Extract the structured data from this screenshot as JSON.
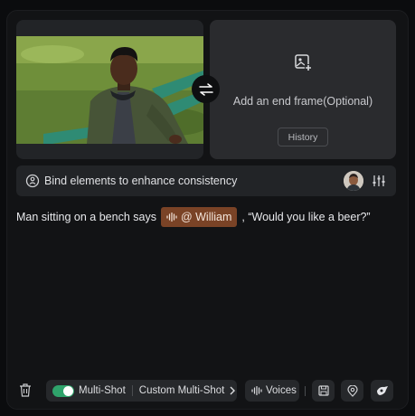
{
  "start_frame": {
    "image_icon": "person-on-bench-photo"
  },
  "swap": {
    "icon": "swap-arrows-icon"
  },
  "end_frame": {
    "icon": "add-image-icon",
    "text": "Add an end frame(Optional)",
    "history_label": "History"
  },
  "bind": {
    "icon": "link-elements-icon",
    "text": "Bind elements to enhance consistency",
    "avatar_icon": "avatar",
    "settings_icon": "sliders-icon"
  },
  "prompt": {
    "before": "Man sitting on a bench says",
    "mention": "@ William",
    "after": ", “Would you like a beer?”"
  },
  "toolbar": {
    "multishot_label": "Multi-Shot",
    "multishot_enabled": true,
    "custom_label": "Custom Multi-Shot",
    "voices_label": "Voices"
  },
  "colors": {
    "accent_green": "#2fa36b",
    "mention_bg": "#7a4326",
    "panel_bg": "#121315"
  }
}
